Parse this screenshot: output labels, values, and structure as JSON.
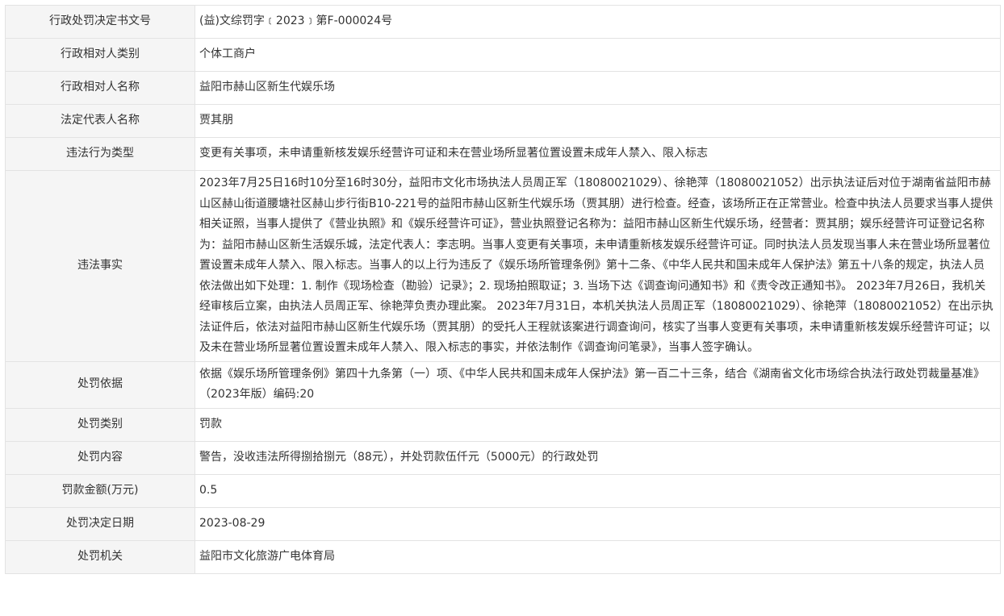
{
  "rows": [
    {
      "label": "行政处罚决定书文号",
      "value": "(益)文综罚字﹝2023﹞第F-000024号"
    },
    {
      "label": "行政相对人类别",
      "value": "个体工商户"
    },
    {
      "label": "行政相对人名称",
      "value": "益阳市赫山区新生代娱乐场"
    },
    {
      "label": "法定代表人名称",
      "value": "贾其朋"
    },
    {
      "label": "违法行为类型",
      "value": "变更有关事项，未申请重新核发娱乐经营许可证和未在营业场所显著位置设置未成年人禁入、限入标志"
    },
    {
      "label": "违法事实",
      "value": "2023年7月25日16时10分至16时30分，益阳市文化市场执法人员周正军（18080021029）、徐艳萍（18080021052）出示执法证后对位于湖南省益阳市赫山区赫山街道腰塘社区赫山步行街B10-221号的益阳市赫山区新生代娱乐场（贾其朋）进行检查。经查，该场所正在正常营业。检查中执法人员要求当事人提供相关证照，当事人提供了《营业执照》和《娱乐经营许可证》，营业执照登记名称为：益阳市赫山区新生代娱乐场，经营者：贾其朋；娱乐经营许可证登记名称为：益阳市赫山区新生活娱乐城，法定代表人：李志明。当事人变更有关事项，未申请重新核发娱乐经营许可证。同时执法人员发现当事人未在营业场所显著位置设置未成年人禁入、限入标志。当事人的以上行为违反了《娱乐场所管理条例》第十二条、《中华人民共和国未成年人保护法》第五十八条的规定，执法人员依法做出如下处理：1. 制作《现场检查（勘验）记录》；2. 现场拍照取证；3. 当场下达《调查询问通知书》和《责令改正通知书》。 2023年7月26日，我机关经审核后立案，由执法人员周正军、徐艳萍负责办理此案。 2023年7月31日，本机关执法人员周正军（18080021029）、徐艳萍（18080021052）在出示执法证件后，依法对益阳市赫山区新生代娱乐场（贾其朋）的受托人王程就该案进行调查询问，核实了当事人变更有关事项，未申请重新核发娱乐经营许可证；以及未在营业场所显著位置设置未成年人禁入、限入标志的事实，并依法制作《调查询问笔录》，当事人签字确认。"
    },
    {
      "label": "处罚依据",
      "value": "依据《娱乐场所管理条例》第四十九条第（一）项、《中华人民共和国未成年人保护法》第一百二十三条，结合《湖南省文化市场综合执法行政处罚裁量基准》（2023年版）编码:20"
    },
    {
      "label": "处罚类别",
      "value": "罚款"
    },
    {
      "label": "处罚内容",
      "value": "警告，没收违法所得捌拾捌元（88元），并处罚款伍仟元（5000元）的行政处罚"
    },
    {
      "label": "罚款金额(万元)",
      "value": "0.5"
    },
    {
      "label": "处罚决定日期",
      "value": "2023-08-29"
    },
    {
      "label": "处罚机关",
      "value": "益阳市文化旅游广电体育局"
    }
  ]
}
